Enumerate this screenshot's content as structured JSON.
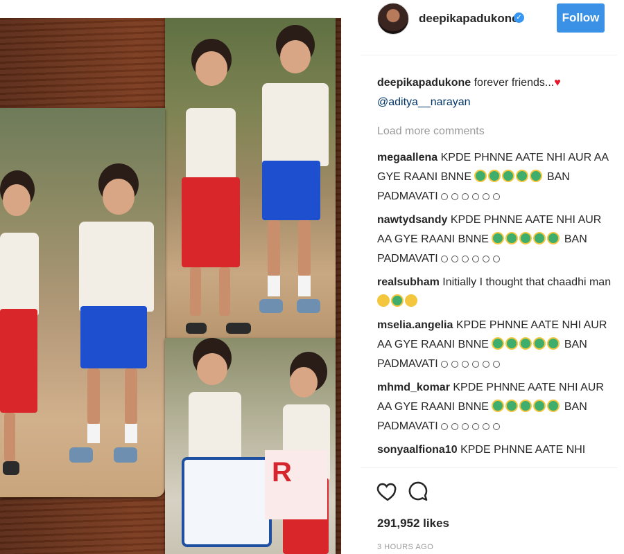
{
  "post": {
    "username": "deepikapadukone",
    "follow_label": "Follow",
    "caption_text": "forever friends...",
    "caption_mention": "@aditya__narayan",
    "load_more": "Load more comments",
    "likes": "291,952 likes",
    "time": "3 HOURS AGO"
  },
  "comments": [
    {
      "user": "megaallena",
      "text": "KPDE PHNNE AATE NHI AUR AA GYE RAANI BNNE",
      "tail": "BAN PADMAVATI"
    },
    {
      "user": "nawtydsandy",
      "text": "KPDE PHNNE AATE NHI AUR AA GYE RAANI BNNE",
      "tail": "BAN PADMAVATI"
    },
    {
      "user": "realsubham",
      "text": "Initially I thought that chaadhi man",
      "tail": ""
    },
    {
      "user": "mselia.angelia",
      "text": "KPDE PHNNE AATE NHI AUR AA GYE RAANI BNNE",
      "tail": "BAN PADMAVATI"
    },
    {
      "user": "mhmd_komar",
      "text": "KPDE PHNNE AATE NHI AUR AA GYE RAANI BNNE",
      "tail": "BAN PADMAVATI"
    },
    {
      "user": "sonyaalfiona10",
      "text": "KPDE PHNNE AATE NHI",
      "tail": ""
    }
  ],
  "icons": {
    "like": "heart-icon",
    "comment": "comment-icon",
    "verified": "verified-badge-icon"
  },
  "colors": {
    "follow_button": "#3b91e6",
    "mention": "#003569",
    "verified": "#3897f0"
  }
}
